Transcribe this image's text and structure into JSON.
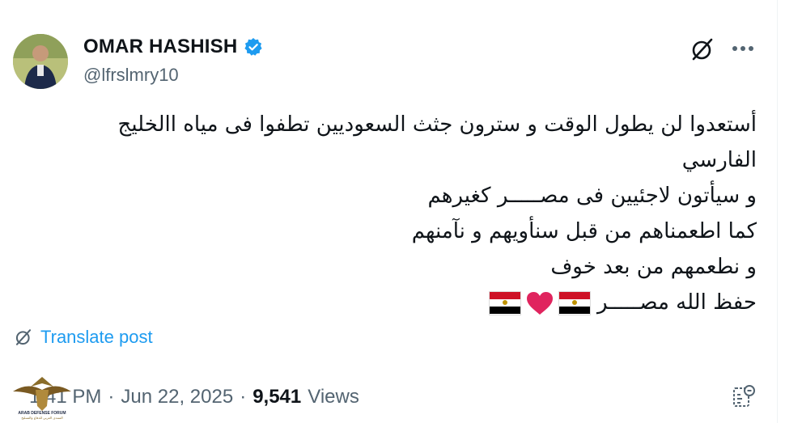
{
  "author": {
    "display_name": "OMAR HASHISH",
    "handle": "@lfrslmry10",
    "verified": true
  },
  "icons": {
    "verified": "verified-badge-icon",
    "grok": "grok-icon",
    "more": "more-icon",
    "translate": "translate-icon",
    "analytics": "analytics-icon"
  },
  "tweet": {
    "lines": [
      "أستعدوا لن يطول الوقت و سترون جثث السعوديين تطفوا فى مياه االخليج",
      "الفارسي",
      "و سيأتون لاجئيين فى مصـــــر كغيرهم",
      "كما اطعمناهم من قبل سنأويهم و نآمنهم",
      "و نطعمهم من بعد خوف",
      "حفظ الله مصـــــر"
    ],
    "emoji": [
      "flag-egypt",
      "red-heart",
      "flag-egypt"
    ]
  },
  "translate_label": "Translate post",
  "meta": {
    "time": "1:41 PM",
    "separator": "·",
    "date": "Jun 22, 2025",
    "views_count": "9,541",
    "views_label": "Views"
  },
  "watermark": {
    "title": "ARAB DEFENSE FORUM",
    "subtitle": "المنتدى العربي للدفاع والتسليح"
  },
  "colors": {
    "accent": "#1d9bf0",
    "secondary_text": "#536471",
    "primary_text": "#0f1419",
    "heart": "#e0245e",
    "flag_red": "#ce1126",
    "flag_black": "#000000",
    "flag_white": "#ffffff",
    "eagle_gold": "#c09300"
  }
}
